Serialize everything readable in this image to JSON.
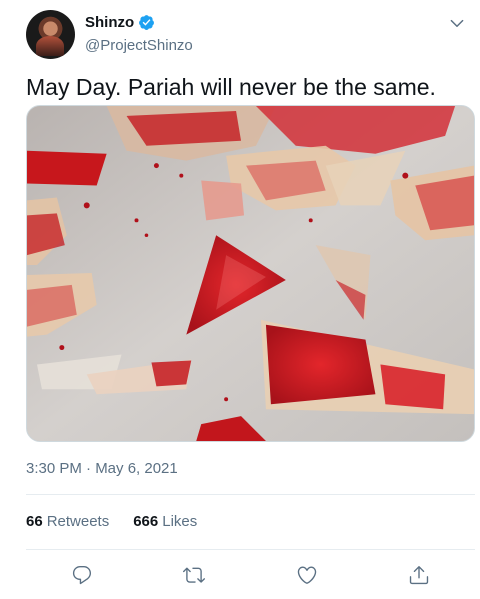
{
  "user": {
    "name": "Shinzo",
    "handle": "@ProjectShinzo",
    "verified": true
  },
  "tweet": {
    "text": "May Day. Pariah will never be the same.",
    "timestamp": "3:30 PM · May 6, 2021"
  },
  "stats": {
    "retweets_count": "66",
    "retweets_label": "Retweets",
    "likes_count": "666",
    "likes_label": "Likes"
  },
  "actions": {
    "reply_icon": "reply-icon",
    "retweet_icon": "retweet-icon",
    "like_icon": "heart-icon",
    "share_icon": "share-icon"
  },
  "colors": {
    "accent": "#1da1f2",
    "secondary_text": "#5b7083",
    "primary_text": "#0f1419",
    "divider": "#e6ecf0"
  }
}
